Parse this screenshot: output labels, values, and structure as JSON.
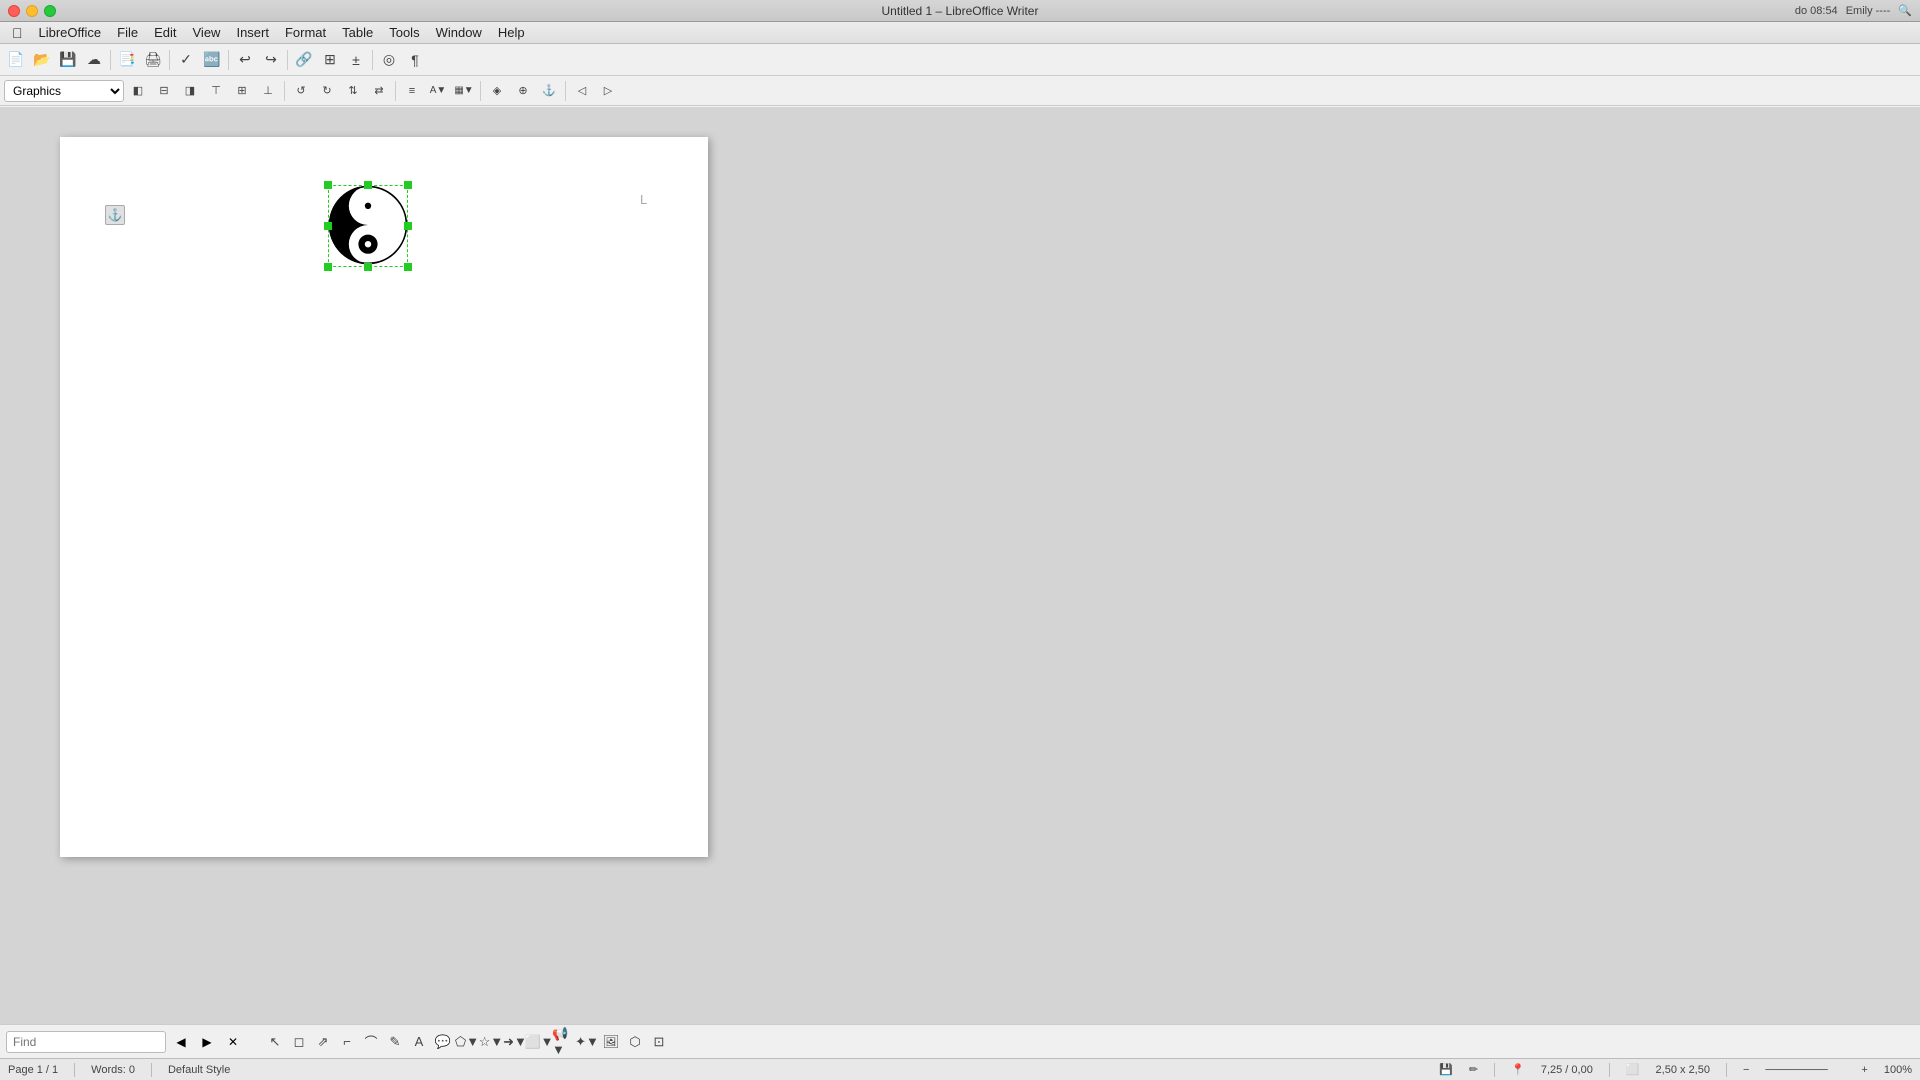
{
  "titlebar": {
    "title": "Untitled 1 – LibreOffice Writer",
    "user": "Emily ----",
    "time": "do 08:54"
  },
  "menubar": {
    "items": [
      "🍎",
      "LibreOffice",
      "File",
      "Edit",
      "View",
      "Insert",
      "Format",
      "Table",
      "Tools",
      "Window",
      "Help"
    ]
  },
  "graphic_toolbar": {
    "style_label": "Graphics",
    "style_options": [
      "Graphics"
    ]
  },
  "status_bar": {
    "page": "Page 1 / 1",
    "words": "Words: 0",
    "style": "Default Style",
    "position": "7,25 / 0,00",
    "size": "2,50 x 2,50",
    "zoom": "100%"
  },
  "find_bar": {
    "label": "Find",
    "placeholder": "Find"
  },
  "document": {
    "image_alt": "Yin Yang symbol"
  }
}
